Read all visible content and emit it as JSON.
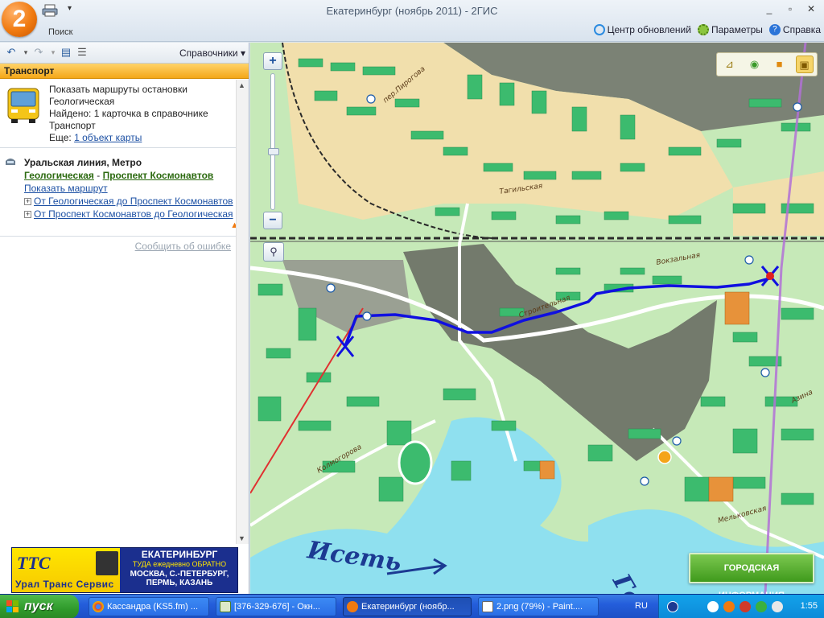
{
  "window": {
    "title": "Екатеринбург (ноябрь 2011)  -  2ГИС",
    "logo_text": "2",
    "search_tab": "Поиск",
    "controls": {
      "minimize": "_",
      "maximize": "▫",
      "close": "✕"
    }
  },
  "ribbon": {
    "update_center": "Центр обновлений",
    "settings": "Параметры",
    "help": "Справка"
  },
  "panel": {
    "directories_label": "Справочники",
    "section_title": "Транспорт",
    "stop_card": {
      "line1": "Показать маршруты остановки",
      "line2": "Геологическая",
      "line3": "Найдено: 1 карточка в справочнике",
      "line4": "Транспорт",
      "line5_prefix": "Еще: ",
      "line5_link": "1 объект карты"
    },
    "metro_card": {
      "title": "Уральская линия, Метро",
      "from_station": "Геологическая",
      "separator": " - ",
      "to_station": "Проспект Космонавтов",
      "show_route": "Показать маршрут",
      "route_forward": "От Геологическая до Проспект Космонавтов",
      "route_back": "От Проспект Космонавтов до Геологическая"
    },
    "report_error": "Сообщить об ошибке"
  },
  "ad": {
    "logo": "ТТС",
    "company": "Урал Транс Сервис",
    "city": "ЕКАТЕРИНБУРГ",
    "schedule": "ТУДА  ежедневно  ОБРАТНО",
    "route1": "МОСКВА, С.-ПЕТЕРБУРГ,",
    "route2": "ПЕРМЬ, КАЗАНЬ"
  },
  "map": {
    "zoom_in": "+",
    "zoom_out": "−",
    "streets": {
      "tagilskaya": "Тагильская",
      "vokzalnaya": "Вокзальная",
      "stroitelnaya": "Строительная",
      "kolmogorova": "Колмогорова",
      "melkovskaya": "Мельковская",
      "azina": "Азина",
      "per_pirogov": "пер.Пирогова"
    },
    "river_left": "Исеть",
    "river_right": "Гор",
    "city_info_button": "ГОРОДСКАЯ ИНФОРМАЦИЯ",
    "colors": {
      "background": "#c6e9b8",
      "route": "#1010e0",
      "river": "#8fe0ef",
      "buildings": "#3cbb6e",
      "industrial": "#737a6c",
      "railway": "#2a2a2a",
      "metro_line": "#b271d6"
    }
  },
  "taskbar": {
    "start": "пуск",
    "tasks": [
      "Кассандра (KS5.fm) ...",
      "[376-329-676] - Окн...",
      "Екатеринбург (ноябр...",
      "2.png (79%) - Paint...."
    ],
    "language": "RU",
    "clock": "1:55"
  }
}
